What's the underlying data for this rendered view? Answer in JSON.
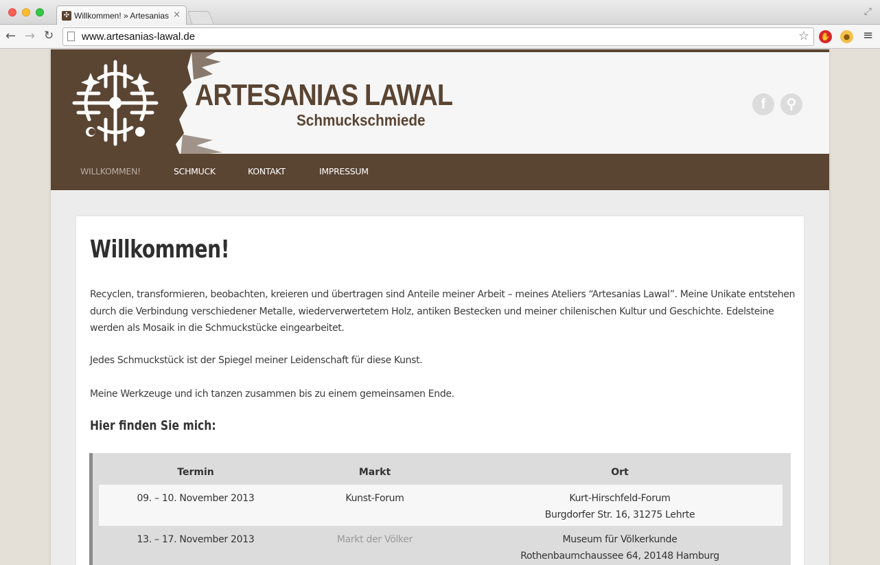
{
  "browser": {
    "tab_title": "Willkommen! » Artesanias Lawal",
    "tab_close": "×",
    "url": "www.artesanias-lawal.de"
  },
  "site": {
    "title": "ARTESANIAS LAWAL",
    "subtitle": "Schmuckschmiede",
    "social": {
      "facebook": "f",
      "search": "⚲"
    }
  },
  "nav": {
    "items": [
      "WILLKOMMEN!",
      "SCHMUCK",
      "KONTAKT",
      "IMPRESSUM"
    ],
    "active_index": 0
  },
  "main": {
    "title": "Willkommen!",
    "paragraphs": [
      "Recyclen, transformieren, beobachten, kreieren und übertragen sind Anteile meiner Arbeit – meines Ateliers “Artesanias Lawal”. Meine Unikate entstehen durch die Verbindung verschiedener Metalle, wiederverwertetem Holz, antiken Bestecken und meiner chilenischen Kultur und Geschichte. Edelsteine werden als Mosaik in die Schmuckstücke eingearbeitet.",
      "Jedes Schmuckstück ist der Spiegel meiner Leidenschaft für diese Kunst.",
      "Meine Werkzeuge und ich tanzen zusammen bis zu einem gemeinsamen Ende."
    ],
    "subheading": "Hier finden Sie mich:",
    "table": {
      "headers": [
        "Termin",
        "Markt",
        "Ort"
      ],
      "rows": [
        {
          "termin": "09. – 10. November 2013",
          "markt": "Kunst-Forum",
          "ort_line1": "Kurt-Hirschfeld-Forum",
          "ort_line2": "Burgdorfer Str. 16, 31275 Lehrte"
        },
        {
          "termin": "13. – 17. November 2013",
          "markt": "Markt der Völker",
          "ort_line1": "Museum für Völkerkunde",
          "ort_line2": "Rothenbaumchaussee 64, 20148 Hamburg"
        }
      ]
    }
  },
  "colors": {
    "brand_brown": "#5a4432",
    "nav_active": "#b9aea5",
    "background": "#e4e0d7"
  }
}
